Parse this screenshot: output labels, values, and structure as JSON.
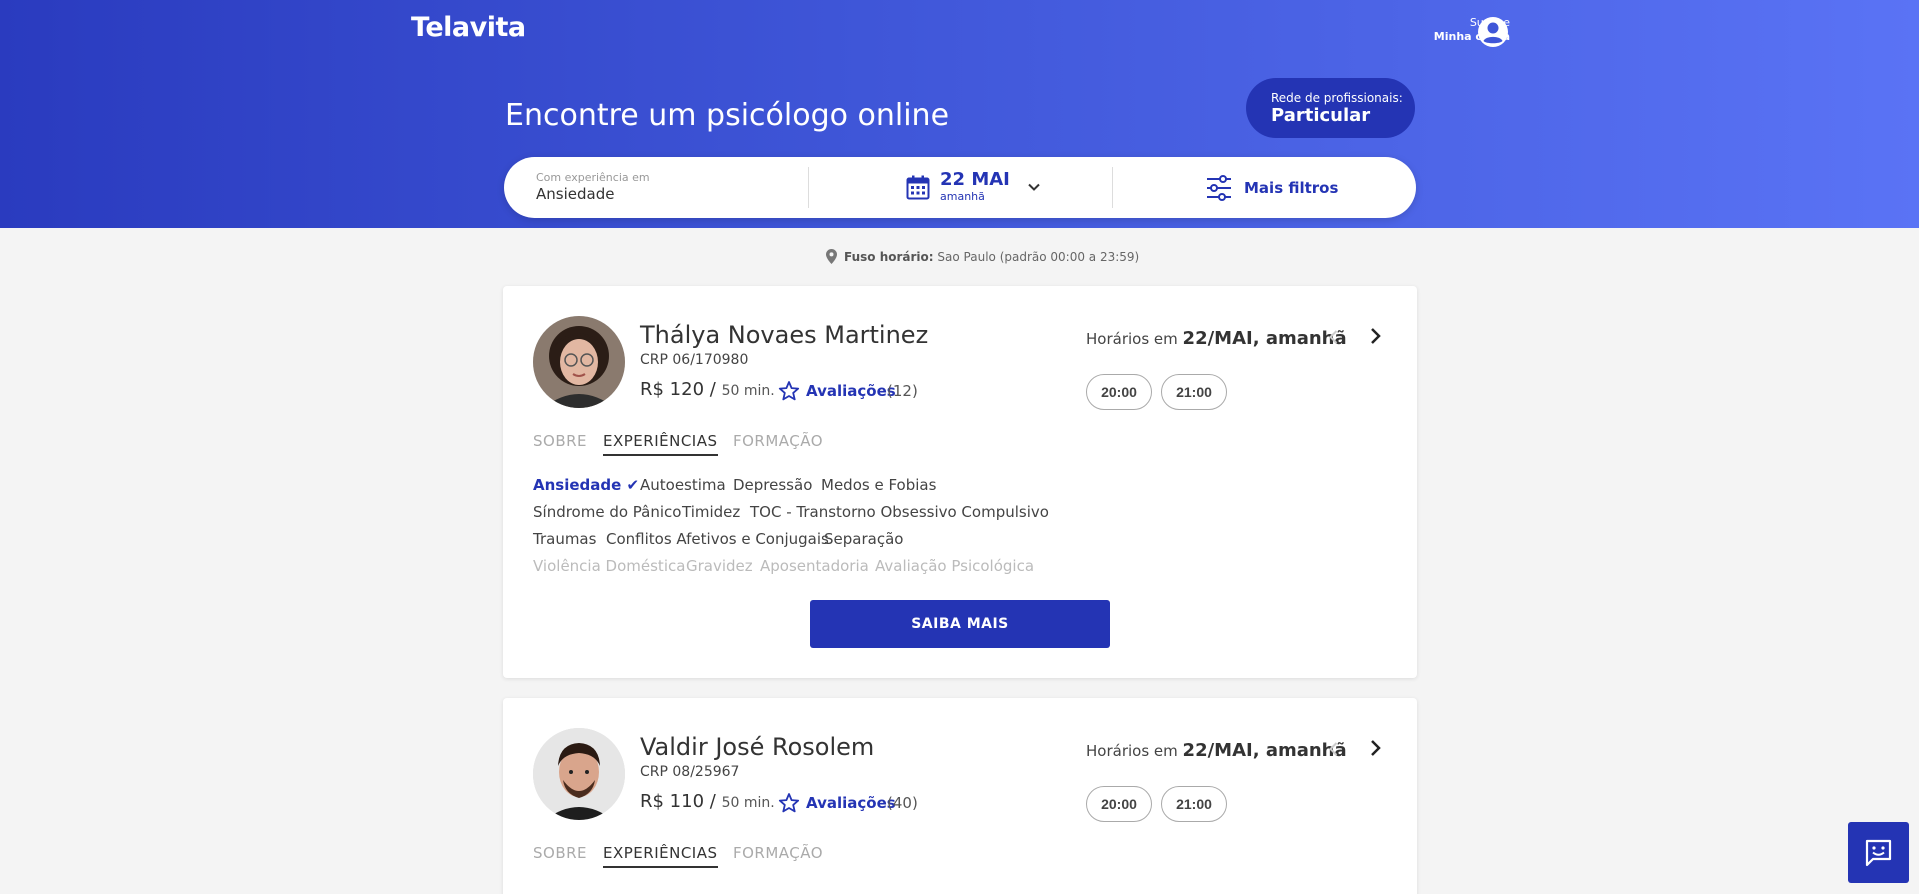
{
  "header": {
    "logo": "Telavita",
    "account_name": "Susane",
    "account_label": "Minha conta"
  },
  "hero": {
    "title": "Encontre um psicólogo online",
    "network_label": "Rede de profissionais:",
    "network_value": "Particular"
  },
  "search": {
    "experience_label": "Com experiência em",
    "experience_value": "Ansiedade",
    "date_value": "22 MAI",
    "date_sub": "amanhã",
    "filters_label": "Mais filtros"
  },
  "timezone": {
    "label": "Fuso horário:",
    "value": "Sao Paulo (padrão 00:00 a 23:59)"
  },
  "tabs": [
    "SOBRE",
    "EXPERIÊNCIAS",
    "FORMAÇÃO"
  ],
  "slots_prefix": "Horários em",
  "slots_date": "22/MAI, amanhã",
  "reviews_label": "Avaliações",
  "price_per": "/",
  "more_button": "SAIBA MAIS",
  "professionals": [
    {
      "name": "Thályа Novaes Martinez",
      "crp": "CRP 06/170980",
      "price": "R$ 120",
      "duration": "50 min.",
      "reviews_count": "(12)",
      "slots": [
        "20:00",
        "21:00"
      ],
      "experiences": [
        [
          "Ansiedade ✔",
          "Autoestima",
          "Depressão",
          "Medos e Fobias"
        ],
        [
          "Síndrome do Pânico",
          "Timidez",
          "TOC - Transtorno Obsessivo Compulsivo"
        ],
        [
          "Traumas",
          "Conflitos Afetivos e Conjugais",
          "Separação"
        ],
        [
          "Violência Doméstica",
          "Gravidez",
          "Aposentadoria",
          "Avaliação Psicológica"
        ]
      ]
    },
    {
      "name": "Valdir José Rosolem",
      "crp": "CRP 08/25967",
      "price": "R$ 110",
      "duration": "50 min.",
      "reviews_count": "(40)",
      "slots": [
        "20:00",
        "21:00"
      ]
    }
  ],
  "colors": {
    "primary": "#2434b4",
    "hero_start": "#2a3bbf",
    "hero_end": "#5a73f5",
    "background": "#f4f4f4"
  },
  "icons": [
    "user-account-icon",
    "calendar-icon",
    "chevron-down-icon",
    "filter-sliders-icon",
    "location-pin-icon",
    "star-icon",
    "chevron-left-icon",
    "chevron-right-icon",
    "chat-icon"
  ]
}
